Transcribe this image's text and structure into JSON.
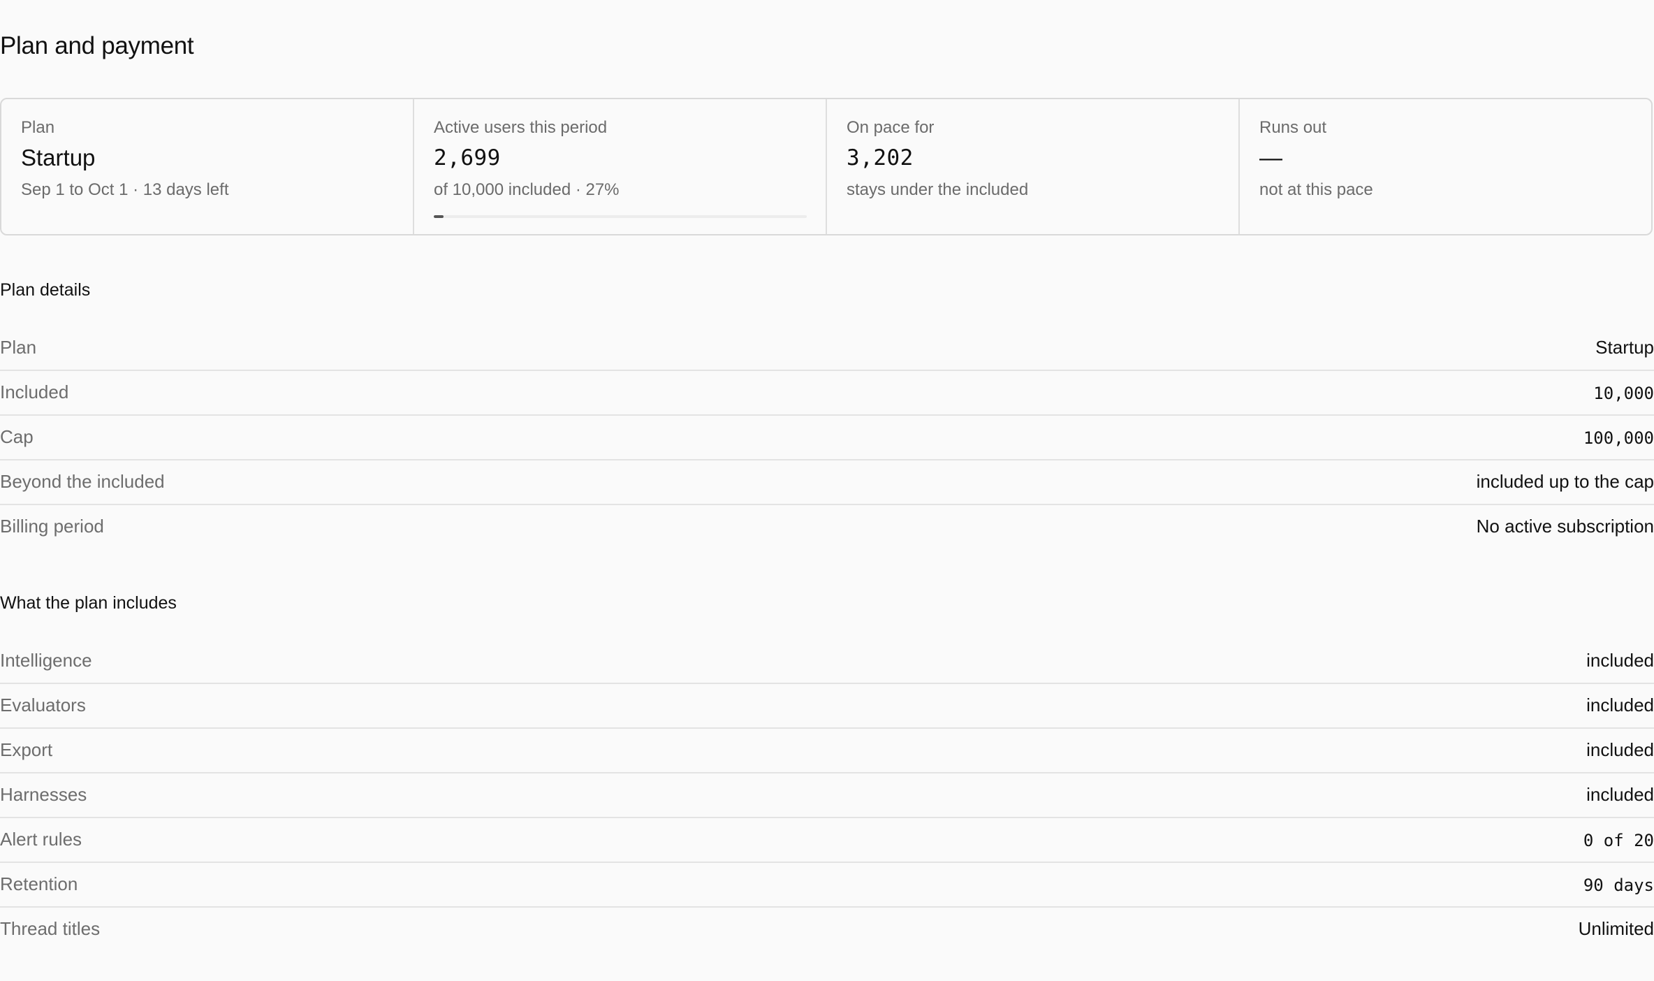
{
  "page": {
    "title": "Plan and payment"
  },
  "summary": {
    "plan": {
      "label": "Plan",
      "value": "Startup",
      "sub": "Sep 1 to Oct 1 · 13 days left"
    },
    "active_users": {
      "label": "Active users this period",
      "value": "2,699",
      "sub": "of 10,000 included · 27%",
      "progress_percent": 2.7
    },
    "on_pace": {
      "label": "On pace for",
      "value": "3,202",
      "sub": "stays under the included"
    },
    "runs_out": {
      "label": "Runs out",
      "value": "—",
      "sub": "not at this pace"
    }
  },
  "plan_details": {
    "heading": "Plan details",
    "rows": [
      {
        "key": "Plan",
        "value": "Startup",
        "mono": false
      },
      {
        "key": "Included",
        "value": "10,000",
        "mono": true
      },
      {
        "key": "Cap",
        "value": "100,000",
        "mono": true
      },
      {
        "key": "Beyond the included",
        "value": "included up to the cap",
        "mono": false
      },
      {
        "key": "Billing period",
        "value": "No active subscription",
        "mono": false
      }
    ]
  },
  "plan_includes": {
    "heading": "What the plan includes",
    "rows": [
      {
        "key": "Intelligence",
        "value": "included",
        "mono": false
      },
      {
        "key": "Evaluators",
        "value": "included",
        "mono": false
      },
      {
        "key": "Export",
        "value": "included",
        "mono": false
      },
      {
        "key": "Harnesses",
        "value": "included",
        "mono": false
      },
      {
        "key": "Alert rules",
        "value": "0 of 20",
        "mono": true
      },
      {
        "key": "Retention",
        "value": "90 days",
        "mono": true
      },
      {
        "key": "Thread titles",
        "value": "Unlimited",
        "mono": false
      }
    ]
  }
}
